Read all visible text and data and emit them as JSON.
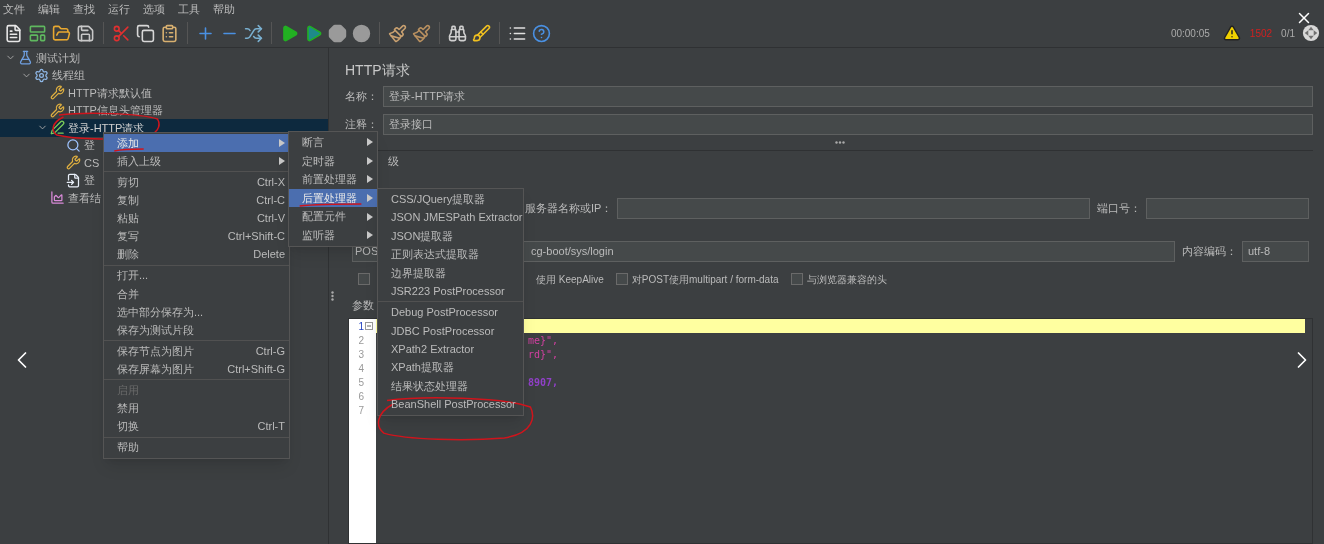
{
  "menu_bar": [
    "文件",
    "编辑",
    "查找",
    "运行",
    "选项",
    "工具",
    "帮助"
  ],
  "status": {
    "elapsed": "00:00:05",
    "errors": "1502",
    "threads": "0/1"
  },
  "tree": [
    {
      "label": "测试计划",
      "kind": "plan",
      "selected": false,
      "expanded": true,
      "children": [
        {
          "label": "线程组",
          "kind": "thread_group",
          "selected": false,
          "expanded": true,
          "children": [
            {
              "label": "HTTP请求默认值",
              "kind": "config",
              "selected": false
            },
            {
              "label": "HTTP信息头管理器",
              "kind": "config",
              "selected": false
            },
            {
              "label": "登录-HTTP请求",
              "kind": "sampler",
              "selected": true,
              "expanded": true,
              "circled": true,
              "children": [
                {
                  "label": "登",
                  "kind": "assertion",
                  "selected": false
                },
                {
                  "label": "CS",
                  "kind": "config",
                  "selected": false
                },
                {
                  "label": "登",
                  "kind": "processor",
                  "selected": false
                }
              ]
            },
            {
              "label": "查看结",
              "kind": "listener",
              "selected": false
            }
          ]
        }
      ]
    }
  ],
  "panel": {
    "title": "HTTP请求",
    "name_label": "名称：",
    "name": "登录-HTTP请求",
    "comment_label": "注释：",
    "comment": "登录接口",
    "section": "级",
    "server_label": "服务器名称或IP：",
    "port_label": "端口号：",
    "method": "POS",
    "path": "cg-boot/sys/login",
    "encoding_label": "内容编码：",
    "encoding": "utf-8",
    "options": [
      {
        "kind": "checkbox",
        "checked": false
      },
      {
        "kind": "label",
        "label": "使用 KeepAlive"
      },
      {
        "kind": "checkbox",
        "label": "对POST使用multipart / form-data",
        "checked": false
      },
      {
        "kind": "checkbox",
        "label": "与浏览器兼容的头",
        "checked": false
      }
    ],
    "params_tab": "参数",
    "editor": [
      {
        "number": "1",
        "current": true
      },
      {
        "number": "2",
        "current": false,
        "code": "me}\",",
        "kind": "string"
      },
      {
        "number": "3",
        "current": false,
        "code": "rd}\",",
        "kind": "string"
      },
      {
        "number": "4",
        "current": false
      },
      {
        "number": "5",
        "current": false,
        "code": "8907,",
        "kind": "number"
      },
      {
        "number": "6",
        "current": false
      },
      {
        "number": "7",
        "current": false
      }
    ]
  },
  "context_menu": [
    {
      "kind": "item",
      "label": "添加",
      "submenu": true,
      "selected": true,
      "disabled": false,
      "underlined": true
    },
    {
      "kind": "item",
      "label": "插入上级",
      "submenu": true,
      "selected": false,
      "disabled": false
    },
    {
      "kind": "separator"
    },
    {
      "kind": "item",
      "label": "剪切",
      "shortcut": "Ctrl-X",
      "selected": false,
      "disabled": false
    },
    {
      "kind": "item",
      "label": "复制",
      "shortcut": "Ctrl-C",
      "selected": false,
      "disabled": false
    },
    {
      "kind": "item",
      "label": "粘贴",
      "shortcut": "Ctrl-V",
      "selected": false,
      "disabled": false
    },
    {
      "kind": "item",
      "label": "复写",
      "shortcut": "Ctrl+Shift-C",
      "selected": false,
      "disabled": false
    },
    {
      "kind": "item",
      "label": "删除",
      "shortcut": "Delete",
      "selected": false,
      "disabled": false
    },
    {
      "kind": "separator"
    },
    {
      "kind": "item",
      "label": "打开...",
      "selected": false,
      "disabled": false
    },
    {
      "kind": "item",
      "label": "合并",
      "selected": false,
      "disabled": false
    },
    {
      "kind": "item",
      "label": "选中部分保存为...",
      "selected": false,
      "disabled": false
    },
    {
      "kind": "item",
      "label": "保存为测试片段",
      "selected": false,
      "disabled": false
    },
    {
      "kind": "separator"
    },
    {
      "kind": "item",
      "label": "保存节点为图片",
      "shortcut": "Ctrl-G",
      "selected": false,
      "disabled": false
    },
    {
      "kind": "item",
      "label": "保存屏幕为图片",
      "shortcut": "Ctrl+Shift-G",
      "selected": false,
      "disabled": false
    },
    {
      "kind": "separator"
    },
    {
      "kind": "item",
      "label": "启用",
      "selected": false,
      "disabled": true
    },
    {
      "kind": "item",
      "label": "禁用",
      "selected": false,
      "disabled": false
    },
    {
      "kind": "item",
      "label": "切换",
      "shortcut": "Ctrl-T",
      "selected": false,
      "disabled": false
    },
    {
      "kind": "separator"
    },
    {
      "kind": "item",
      "label": "帮助",
      "selected": false,
      "disabled": false
    }
  ],
  "add_submenu": [
    {
      "kind": "item",
      "label": "断言",
      "submenu": true,
      "selected": false
    },
    {
      "kind": "item",
      "label": "定时器",
      "submenu": true,
      "selected": false
    },
    {
      "kind": "item",
      "label": "前置处理器",
      "submenu": true,
      "selected": false
    },
    {
      "kind": "item",
      "label": "后置处理器",
      "submenu": true,
      "selected": true,
      "underlined": true
    },
    {
      "kind": "item",
      "label": "配置元件",
      "submenu": true,
      "selected": false
    },
    {
      "kind": "item",
      "label": "监听器",
      "submenu": true,
      "selected": false
    }
  ],
  "post_processor_submenu": [
    {
      "kind": "item",
      "label": "CSS/JQuery提取器",
      "selected": false
    },
    {
      "kind": "item",
      "label": "JSON JMESPath Extractor",
      "selected": false
    },
    {
      "kind": "item",
      "label": "JSON提取器",
      "selected": false
    },
    {
      "kind": "item",
      "label": "正则表达式提取器",
      "selected": false
    },
    {
      "kind": "item",
      "label": "边界提取器",
      "selected": false
    },
    {
      "kind": "item",
      "label": "JSR223 PostProcessor",
      "selected": false
    },
    {
      "kind": "separator"
    },
    {
      "kind": "item",
      "label": "Debug PostProcessor",
      "selected": false
    },
    {
      "kind": "item",
      "label": "JDBC PostProcessor",
      "selected": false
    },
    {
      "kind": "item",
      "label": "XPath2 Extractor",
      "selected": false
    },
    {
      "kind": "item",
      "label": "XPath提取器",
      "selected": false
    },
    {
      "kind": "item",
      "label": "结果状态处理器",
      "selected": false
    },
    {
      "kind": "item",
      "label": "BeanShell PostProcessor",
      "selected": false,
      "circled": true
    }
  ]
}
